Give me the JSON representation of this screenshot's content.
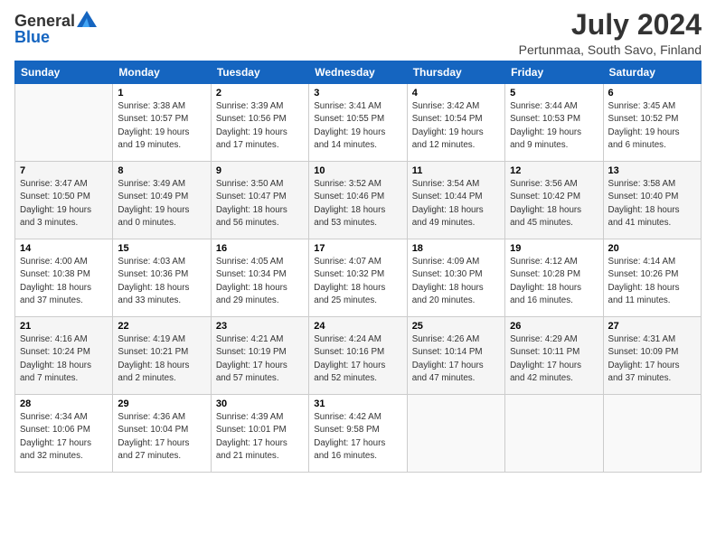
{
  "header": {
    "logo_general": "General",
    "logo_blue": "Blue",
    "title": "July 2024",
    "location": "Pertunmaa, South Savo, Finland"
  },
  "calendar": {
    "days_of_week": [
      "Sunday",
      "Monday",
      "Tuesday",
      "Wednesday",
      "Thursday",
      "Friday",
      "Saturday"
    ],
    "weeks": [
      [
        {
          "day": "",
          "info": ""
        },
        {
          "day": "1",
          "info": "Sunrise: 3:38 AM\nSunset: 10:57 PM\nDaylight: 19 hours\nand 19 minutes."
        },
        {
          "day": "2",
          "info": "Sunrise: 3:39 AM\nSunset: 10:56 PM\nDaylight: 19 hours\nand 17 minutes."
        },
        {
          "day": "3",
          "info": "Sunrise: 3:41 AM\nSunset: 10:55 PM\nDaylight: 19 hours\nand 14 minutes."
        },
        {
          "day": "4",
          "info": "Sunrise: 3:42 AM\nSunset: 10:54 PM\nDaylight: 19 hours\nand 12 minutes."
        },
        {
          "day": "5",
          "info": "Sunrise: 3:44 AM\nSunset: 10:53 PM\nDaylight: 19 hours\nand 9 minutes."
        },
        {
          "day": "6",
          "info": "Sunrise: 3:45 AM\nSunset: 10:52 PM\nDaylight: 19 hours\nand 6 minutes."
        }
      ],
      [
        {
          "day": "7",
          "info": "Sunrise: 3:47 AM\nSunset: 10:50 PM\nDaylight: 19 hours\nand 3 minutes."
        },
        {
          "day": "8",
          "info": "Sunrise: 3:49 AM\nSunset: 10:49 PM\nDaylight: 19 hours\nand 0 minutes."
        },
        {
          "day": "9",
          "info": "Sunrise: 3:50 AM\nSunset: 10:47 PM\nDaylight: 18 hours\nand 56 minutes."
        },
        {
          "day": "10",
          "info": "Sunrise: 3:52 AM\nSunset: 10:46 PM\nDaylight: 18 hours\nand 53 minutes."
        },
        {
          "day": "11",
          "info": "Sunrise: 3:54 AM\nSunset: 10:44 PM\nDaylight: 18 hours\nand 49 minutes."
        },
        {
          "day": "12",
          "info": "Sunrise: 3:56 AM\nSunset: 10:42 PM\nDaylight: 18 hours\nand 45 minutes."
        },
        {
          "day": "13",
          "info": "Sunrise: 3:58 AM\nSunset: 10:40 PM\nDaylight: 18 hours\nand 41 minutes."
        }
      ],
      [
        {
          "day": "14",
          "info": "Sunrise: 4:00 AM\nSunset: 10:38 PM\nDaylight: 18 hours\nand 37 minutes."
        },
        {
          "day": "15",
          "info": "Sunrise: 4:03 AM\nSunset: 10:36 PM\nDaylight: 18 hours\nand 33 minutes."
        },
        {
          "day": "16",
          "info": "Sunrise: 4:05 AM\nSunset: 10:34 PM\nDaylight: 18 hours\nand 29 minutes."
        },
        {
          "day": "17",
          "info": "Sunrise: 4:07 AM\nSunset: 10:32 PM\nDaylight: 18 hours\nand 25 minutes."
        },
        {
          "day": "18",
          "info": "Sunrise: 4:09 AM\nSunset: 10:30 PM\nDaylight: 18 hours\nand 20 minutes."
        },
        {
          "day": "19",
          "info": "Sunrise: 4:12 AM\nSunset: 10:28 PM\nDaylight: 18 hours\nand 16 minutes."
        },
        {
          "day": "20",
          "info": "Sunrise: 4:14 AM\nSunset: 10:26 PM\nDaylight: 18 hours\nand 11 minutes."
        }
      ],
      [
        {
          "day": "21",
          "info": "Sunrise: 4:16 AM\nSunset: 10:24 PM\nDaylight: 18 hours\nand 7 minutes."
        },
        {
          "day": "22",
          "info": "Sunrise: 4:19 AM\nSunset: 10:21 PM\nDaylight: 18 hours\nand 2 minutes."
        },
        {
          "day": "23",
          "info": "Sunrise: 4:21 AM\nSunset: 10:19 PM\nDaylight: 17 hours\nand 57 minutes."
        },
        {
          "day": "24",
          "info": "Sunrise: 4:24 AM\nSunset: 10:16 PM\nDaylight: 17 hours\nand 52 minutes."
        },
        {
          "day": "25",
          "info": "Sunrise: 4:26 AM\nSunset: 10:14 PM\nDaylight: 17 hours\nand 47 minutes."
        },
        {
          "day": "26",
          "info": "Sunrise: 4:29 AM\nSunset: 10:11 PM\nDaylight: 17 hours\nand 42 minutes."
        },
        {
          "day": "27",
          "info": "Sunrise: 4:31 AM\nSunset: 10:09 PM\nDaylight: 17 hours\nand 37 minutes."
        }
      ],
      [
        {
          "day": "28",
          "info": "Sunrise: 4:34 AM\nSunset: 10:06 PM\nDaylight: 17 hours\nand 32 minutes."
        },
        {
          "day": "29",
          "info": "Sunrise: 4:36 AM\nSunset: 10:04 PM\nDaylight: 17 hours\nand 27 minutes."
        },
        {
          "day": "30",
          "info": "Sunrise: 4:39 AM\nSunset: 10:01 PM\nDaylight: 17 hours\nand 21 minutes."
        },
        {
          "day": "31",
          "info": "Sunrise: 4:42 AM\nSunset: 9:58 PM\nDaylight: 17 hours\nand 16 minutes."
        },
        {
          "day": "",
          "info": ""
        },
        {
          "day": "",
          "info": ""
        },
        {
          "day": "",
          "info": ""
        }
      ]
    ]
  }
}
